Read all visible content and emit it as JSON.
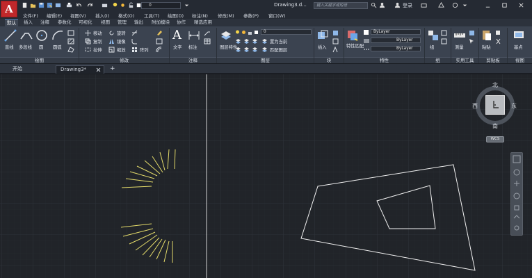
{
  "app": {
    "logo_letter": "A",
    "document_title": "Drawing3.d...",
    "search_placeholder": "键入关键字或短语",
    "login_label": "登录",
    "layer_current": "0"
  },
  "menubar": [
    "文件(F)",
    "编辑(E)",
    "视图(V)",
    "插入(I)",
    "格式(O)",
    "工具(T)",
    "绘图(D)",
    "标注(N)",
    "修改(M)",
    "参数(P)",
    "窗口(W)"
  ],
  "ribbon_tabs": [
    {
      "label": "默认",
      "active": true
    },
    {
      "label": "插入",
      "active": false
    },
    {
      "label": "注释",
      "active": false
    },
    {
      "label": "参数化",
      "active": false
    },
    {
      "label": "可视化",
      "active": false
    },
    {
      "label": "视图",
      "active": false
    },
    {
      "label": "管理",
      "active": false
    },
    {
      "label": "输出",
      "active": false
    },
    {
      "label": "附加模块",
      "active": false
    },
    {
      "label": "协作",
      "active": false
    },
    {
      "label": "精选应用",
      "active": false
    }
  ],
  "ribbon": {
    "draw": {
      "line": "直线",
      "polyline": "多段线",
      "circle": "圆",
      "arc": "圆弧",
      "panel": "绘图"
    },
    "modify": {
      "move": "移动",
      "rotate": "旋转",
      "copy": "复制",
      "mirror": "镜像",
      "stretch": "拉伸",
      "scale": "缩放",
      "array": "阵列",
      "panel": "修改"
    },
    "annotation": {
      "text": "文字",
      "dimension": "标注",
      "panel": "注释"
    },
    "layers": {
      "properties": "图层特性",
      "current_layer": "0",
      "set_current": "置为当前",
      "match_layer": "匹配图层",
      "panel": "图层"
    },
    "block": {
      "insert": "插入",
      "panel": "块"
    },
    "properties": {
      "match": "特性匹配",
      "bylayer_1": "ByLayer",
      "bylayer_2": "ByLayer",
      "bylayer_3": "ByLayer",
      "panel": "特性"
    },
    "groups": {
      "group": "组",
      "panel": "组"
    },
    "utilities": {
      "measure": "测量",
      "panel": "实用工具"
    },
    "clipboard": {
      "paste": "粘贴",
      "panel": "剪贴板"
    },
    "view": {
      "base": "基点",
      "panel": "视图"
    }
  },
  "doc_tabs": {
    "start": "开始",
    "drawing": "Drawing3*",
    "add": "+"
  },
  "viewcube": {
    "north": "北",
    "south": "南",
    "east": "东",
    "west": "西",
    "ucs": "WCS"
  },
  "colors": {
    "accent": "#c0282b",
    "ray_lines": "#e5dc6a",
    "drawing_lines": "#ffffff",
    "canvas_bg": "#212429"
  }
}
